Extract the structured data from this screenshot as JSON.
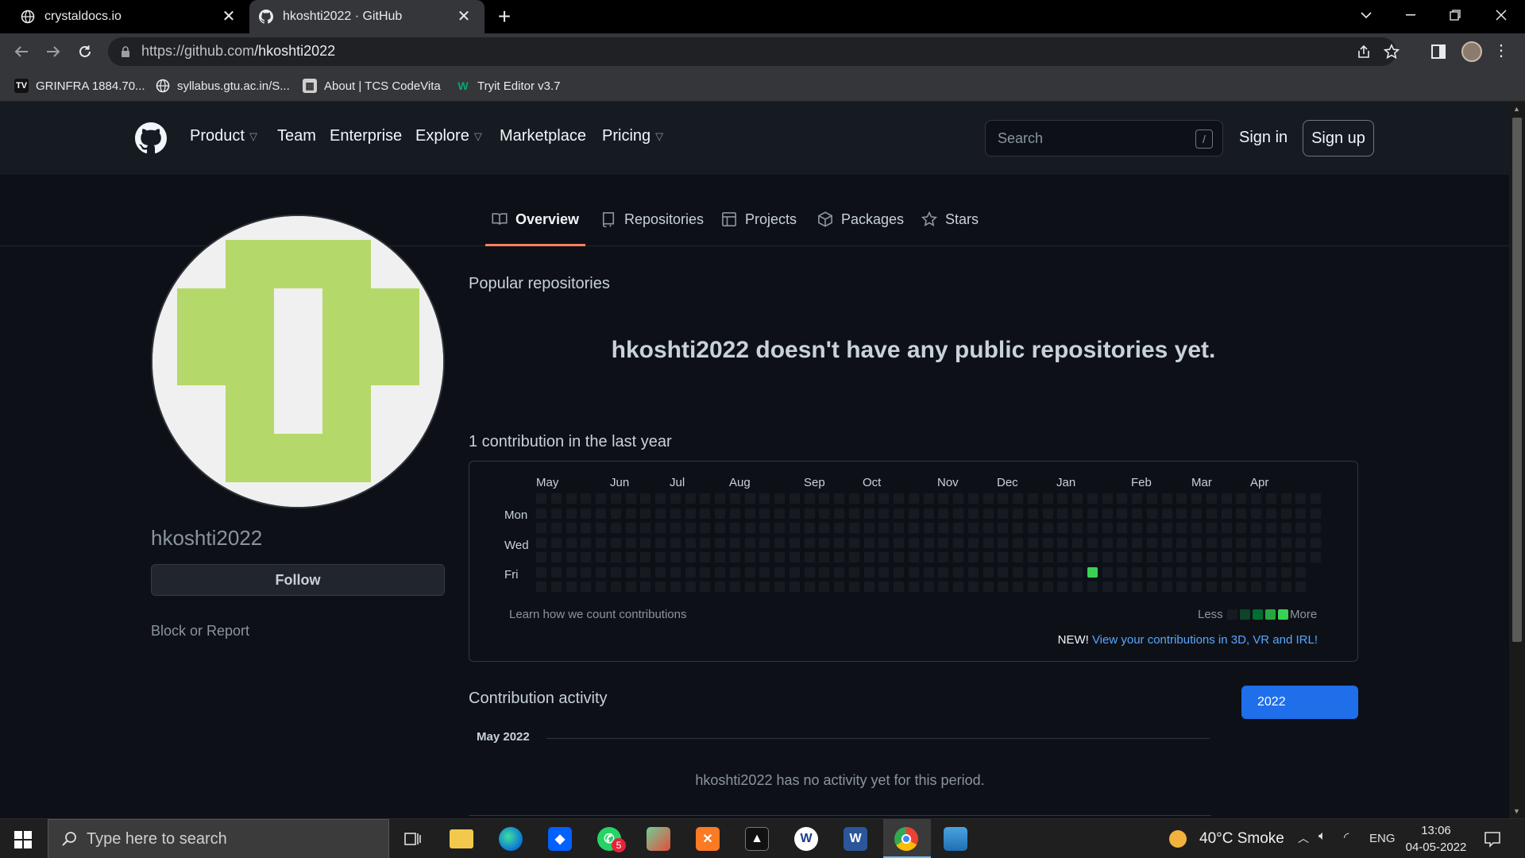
{
  "browser": {
    "tabs": [
      {
        "title": "crystaldocs.io"
      },
      {
        "title": "hkoshti2022 · GitHub"
      }
    ],
    "url_domain": "https://github.com",
    "url_path": "/hkoshti2022",
    "bookmarks": [
      {
        "label": "GRINFRA 1884.70..."
      },
      {
        "label": "syllabus.gtu.ac.in/S..."
      },
      {
        "label": "About | TCS CodeVita"
      },
      {
        "label": "Tryit Editor v3.7"
      }
    ]
  },
  "header": {
    "nav": [
      "Product",
      "Team",
      "Enterprise",
      "Explore",
      "Marketplace",
      "Pricing"
    ],
    "search_placeholder": "Search",
    "search_shortcut": "/",
    "sign_in": "Sign in",
    "sign_up": "Sign up"
  },
  "profile_nav": [
    "Overview",
    "Repositories",
    "Projects",
    "Packages",
    "Stars"
  ],
  "profile": {
    "username": "hkoshti2022",
    "follow_label": "Follow",
    "block_label": "Block or Report"
  },
  "main": {
    "popular_title": "Popular repositories",
    "no_repos": "hkoshti2022 doesn't have any public repositories yet.",
    "contrib_title": "1 contribution in the last year",
    "months": [
      "May",
      "Jun",
      "Jul",
      "Aug",
      "Sep",
      "Oct",
      "Nov",
      "Dec",
      "Jan",
      "Feb",
      "Mar",
      "Apr"
    ],
    "days": [
      "Mon",
      "Wed",
      "Fri"
    ],
    "learn_link": "Learn how we count contributions",
    "legend_less": "Less",
    "legend_more": "More",
    "new_prefix": "NEW!",
    "new_link": "View your contributions in 3D, VR and IRL!",
    "activity_title": "Contribution activity",
    "year_button": "2022",
    "month_label": "May 2022",
    "no_activity": "hkoshti2022 has no activity yet for this period."
  },
  "contributions": {
    "weeks": 53,
    "last_week_days": 5,
    "active_cell": {
      "week": 37,
      "day": 5,
      "count": 1
    }
  },
  "colors": {
    "empty": "#161b22",
    "levels": [
      "#0e4429",
      "#006d32",
      "#26a641",
      "#39d353"
    ],
    "accent": "#1f6feb",
    "tab_underline": "#f78166",
    "identicon": "#b5d86a"
  },
  "taskbar": {
    "search_placeholder": "Type here to search",
    "whatsapp_badge": "5",
    "weather": "40°C  Smoke",
    "lang": "ENG",
    "time": "13:06",
    "date": "04-05-2022"
  }
}
